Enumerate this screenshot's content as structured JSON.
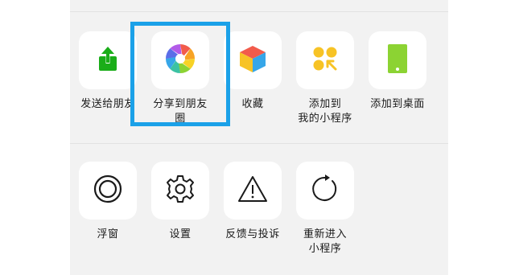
{
  "row1": [
    {
      "label": "发送给朋友",
      "icon": "send-to-friend-icon"
    },
    {
      "label": "分享到朋友\n圈",
      "icon": "moments-shutter-icon"
    },
    {
      "label": "收藏",
      "icon": "favorite-cube-icon"
    },
    {
      "label": "添加到\n我的小程序",
      "icon": "add-mini-program-icon"
    },
    {
      "label": "添加到桌面",
      "icon": "add-to-desktop-icon"
    }
  ],
  "row2": [
    {
      "label": "浮窗",
      "icon": "floating-window-icon"
    },
    {
      "label": "设置",
      "icon": "gear-icon"
    },
    {
      "label": "反馈与投诉",
      "icon": "warning-icon"
    },
    {
      "label": "重新进入\n小程序",
      "icon": "reload-icon"
    }
  ],
  "colors": {
    "highlight": "#1ba1e8",
    "send_icon": "#1aad19",
    "favorite_top": "#f25b4b",
    "favorite_left": "#f7c325",
    "favorite_right": "#36a6e8",
    "mini_program": "#f7c325",
    "desktop": "#8cd333",
    "sheet_bg": "#f2f2f2"
  }
}
